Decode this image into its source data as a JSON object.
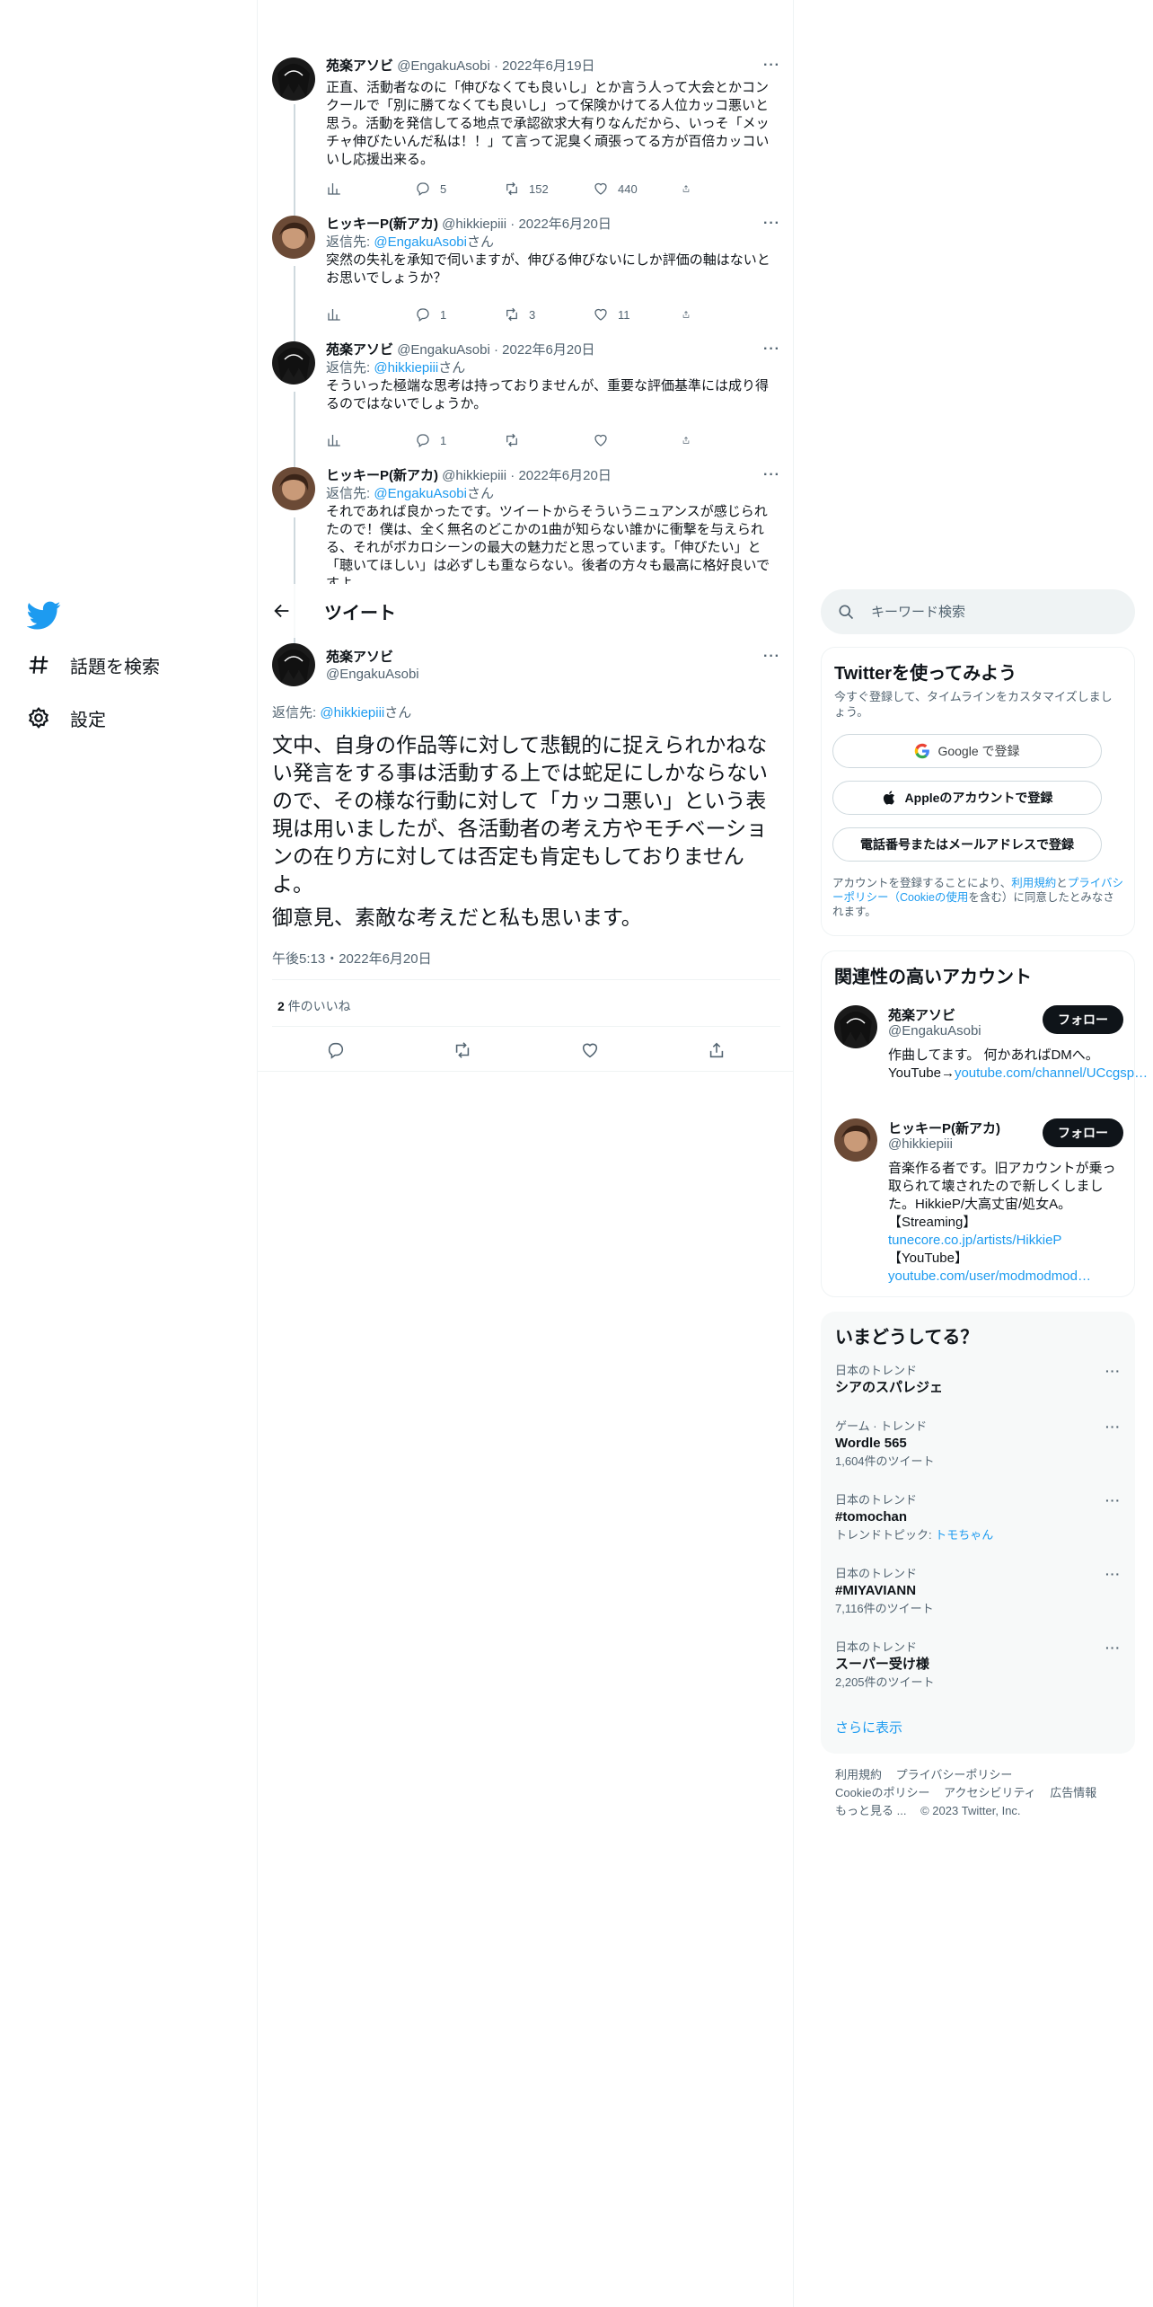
{
  "nav": {
    "explore": "話題を検索",
    "settings": "設定"
  },
  "thread": [
    {
      "name": "苑楽アソビ",
      "handle": "@EngakuAsobi",
      "date": "2022年6月19日",
      "reply_prefix": "",
      "reply_to": "",
      "reply_suffix": "",
      "text": "正直、活動者なのに「伸びなくても良いし」とか言う人って大会とかコンクールで「別に勝てなくても良いし」って保険かけてる人位カッコ悪いと思う。活動を発信してる地点で承認欲求大有りなんだから、いっそ「メッチャ伸びたいんだ私は！！」て言って泥臭く頑張ってる方が百倍カッコいいし応援出来る。",
      "replies": "5",
      "retweets": "152",
      "likes": "440"
    },
    {
      "name": "ヒッキーP(新アカ)",
      "handle": "@hikkiepiii",
      "date": "2022年6月20日",
      "reply_prefix": "返信先: ",
      "reply_to": "@EngakuAsobi",
      "reply_suffix": "さん",
      "text": "突然の失礼を承知で伺いますが、伸びる伸びないにしか評価の軸はないとお思いでしょうか？",
      "replies": "1",
      "retweets": "3",
      "likes": "11"
    },
    {
      "name": "苑楽アソビ",
      "handle": "@EngakuAsobi",
      "date": "2022年6月20日",
      "reply_prefix": "返信先: ",
      "reply_to": "@hikkiepiii",
      "reply_suffix": "さん",
      "text": "そういった極端な思考は持っておりませんが、重要な評価基準には成り得るのではないでしょうか。",
      "replies": "1",
      "retweets": "",
      "likes": ""
    },
    {
      "name": "ヒッキーP(新アカ)",
      "handle": "@hikkiepiii",
      "date": "2022年6月20日",
      "reply_prefix": "返信先: ",
      "reply_to": "@EngakuAsobi",
      "reply_suffix": "さん",
      "text": "それであれば良かったです。ツイートからそういうニュアンスが感じられたので！僕は、全く無名のどこかの1曲が知らない誰かに衝撃を与えられる、それがボカロシーンの最大の魅力だと思っています。「伸びたい」と「聴いてほしい」は必ずしも重ならない。後者の方々も最高に格好良いですよ",
      "replies": "",
      "retweets": "",
      "likes": ""
    }
  ],
  "header": {
    "title": "ツイート"
  },
  "focus": {
    "name": "苑楽アソビ",
    "handle": "@EngakuAsobi",
    "reply_prefix": "返信先: ",
    "reply_to": "@hikkiepiii",
    "reply_suffix": "さん",
    "text": "文中、自身の作品等に対して悲観的に捉えられかねない発言をする事は活動する上では蛇足にしかならないので、その様な行動に対して「カッコ悪い」という表現は用いましたが、各活動者の考え方やモチベーションの在り方に対しては否定も肯定もしておりませんよ。",
    "text2": "御意見、素敵な考えだと私も思います。",
    "time": "午後5:13・2022年6月20日",
    "likes_count": "2",
    "likes_label": " 件のいいね"
  },
  "search": {
    "placeholder": "キーワード検索"
  },
  "signup": {
    "title": "Twitterを使ってみよう",
    "subtitle": "今すぐ登録して、タイムラインをカスタマイズしましょう。",
    "google": "Google で登録",
    "apple": "Appleのアカウントで登録",
    "phone": "電話番号またはメールアドレスで登録",
    "terms_1": "アカウントを登録することにより、",
    "terms_link1": "利用規約",
    "terms_2": "と",
    "terms_link2": "プライバシーポリシー（Cookieの使用",
    "terms_3": "を含む）に同意したとみなされます。"
  },
  "related": {
    "title": "関連性の高いアカウント",
    "follow_label": "フォロー",
    "accounts": [
      {
        "name": "苑楽アソビ",
        "handle": "@EngakuAsobi",
        "bio": "作曲してます。 何かあればDMへ。 YouTube→",
        "link": "youtube.com/channel/UCcgsp…"
      },
      {
        "name": "ヒッキーP(新アカ)",
        "handle": "@hikkiepiii",
        "bio": "音楽作る者です。旧アカウントが乗っ取られて壊されたので新しくしました。HikkieP/大高丈宙/処女A。【Streaming】",
        "link": "tunecore.co.jp/artists/HikkieP",
        "bio2": "【YouTube】",
        "link2": "youtube.com/user/modmodmod…"
      }
    ]
  },
  "trends": {
    "title": "いまどうしてる？",
    "items": [
      {
        "category": "日本のトレンド",
        "name": "シアのスパレジェ",
        "count": ""
      },
      {
        "category": "ゲーム · トレンド",
        "name": "Wordle 565",
        "count": "1,604件のツイート"
      },
      {
        "category": "日本のトレンド",
        "name": "#tomochan",
        "count": "トレンドトピック: ",
        "count_link": "トモちゃん"
      },
      {
        "category": "日本のトレンド",
        "name": "#MIYAVIANN",
        "count": "7,116件のツイート"
      },
      {
        "category": "日本のトレンド",
        "name": "スーパー受け様",
        "count": "2,205件のツイート"
      }
    ],
    "show_more": "さらに表示"
  },
  "footer": {
    "terms": "利用規約",
    "privacy": "プライバシーポリシー",
    "cookie": "Cookieのポリシー",
    "accessibility": "アクセシビリティ",
    "ads": "広告情報",
    "more": "もっと見る ...",
    "copyright": "© 2023 Twitter, Inc."
  },
  "colors": {
    "accent": "#1d9bf0",
    "text": "#0f1419",
    "muted": "#536471",
    "border": "#eff3f4"
  }
}
